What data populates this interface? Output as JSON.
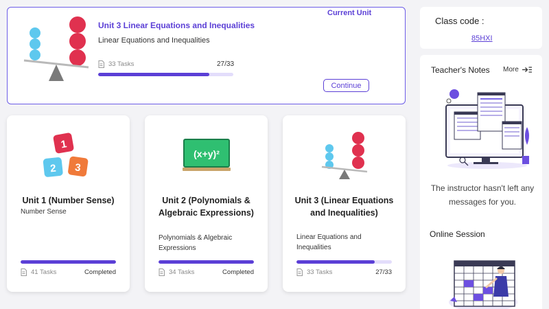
{
  "current_unit": {
    "badge": "Current Unit",
    "title": "Unit 3 Linear Equations and Inequalities",
    "subtitle": "Linear Equations and Inequalities",
    "tasks": "33 Tasks",
    "count": "27/33",
    "progress": 0.82,
    "button": "Continue"
  },
  "units": [
    {
      "title": "Unit 1 (Number Sense)",
      "subtitle": "Number Sense",
      "tasks": "41 Tasks",
      "status": "Completed",
      "progress": 1.0
    },
    {
      "title": "Unit 2 (Polynomials & Algebraic Expressions)",
      "subtitle": "Polynomials & Algebraic Expressions",
      "tasks": "34 Tasks",
      "status": "Completed",
      "progress": 1.0
    },
    {
      "title": "Unit 3 (Linear Equations and Inequalities)",
      "subtitle": "Linear Equations and Inequalities",
      "tasks": "33 Tasks",
      "status": "27/33",
      "progress": 0.82
    }
  ],
  "sidebar": {
    "class_label": "Class code :",
    "class_code": "85HXI",
    "notes_title": "Teacher's Notes",
    "more_label": "More",
    "notes_message": "The instructor hasn't left any messages for you.",
    "online_title": "Online Session"
  },
  "dice_numbers": [
    "1",
    "2",
    "3"
  ],
  "formula_text": "(x+y)²",
  "colors": {
    "accent": "#5b3fd6",
    "track": "#e3ddfb",
    "ball_red": "#e0314f",
    "ball_blue": "#5ec8ee"
  }
}
